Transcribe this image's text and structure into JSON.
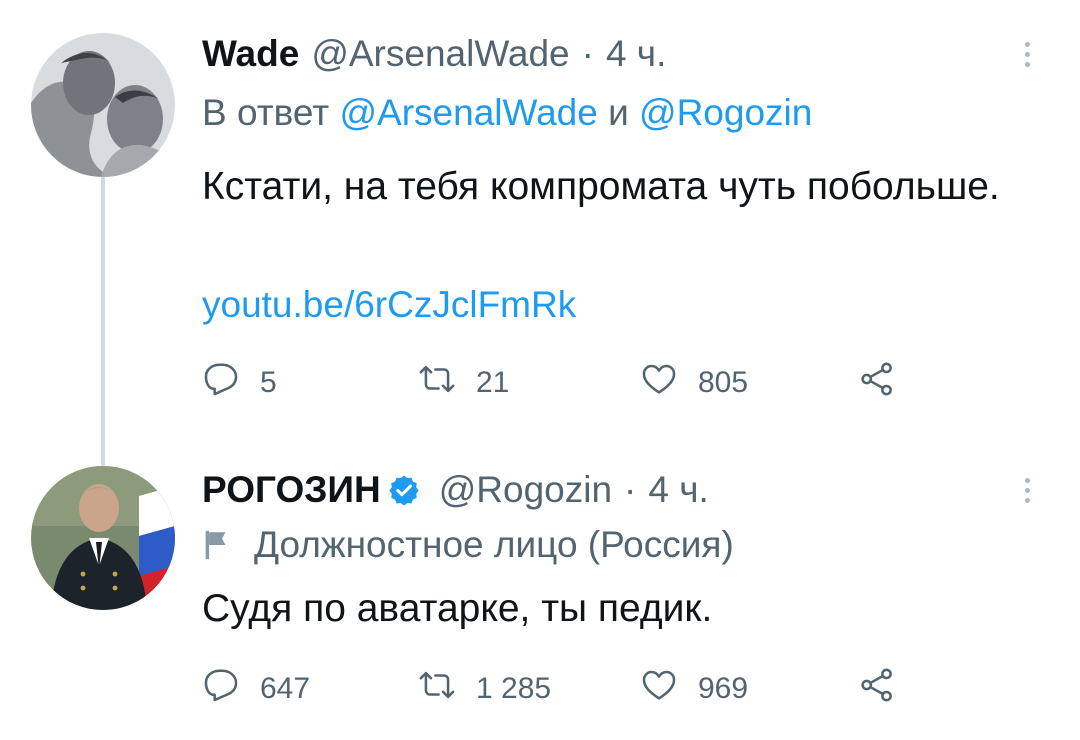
{
  "tweets": [
    {
      "display_name": "Wade",
      "handle": "@ArsenalWade",
      "separator": "·",
      "time": "4 ч.",
      "reply_prefix": "В ответ",
      "reply_mention_1": "@ArsenalWade",
      "reply_joiner": "и",
      "reply_mention_2": "@Rogozin",
      "text": "Кстати, на тебя компромата чуть побольше.",
      "link": "youtu.be/6rCzJclFmRk",
      "replies": "5",
      "retweets": "21",
      "likes": "805",
      "verified": false
    },
    {
      "display_name": "РОГОЗИН",
      "handle": "@Rogozin",
      "separator": "·",
      "time": "4 ч.",
      "label": "Должностное лицо (Россия)",
      "text": "Судя по аватарке, ты педик.",
      "replies": "647",
      "retweets": "1 285",
      "likes": "969",
      "verified": true
    }
  ],
  "icons": {
    "reply": "reply-icon",
    "retweet": "retweet-icon",
    "like": "heart-icon",
    "share": "share-icon",
    "more": "more-icon",
    "verified": "verified-badge-icon",
    "label": "flag-icon"
  },
  "colors": {
    "accent": "#1d9bf0",
    "secondary_text": "#536471",
    "primary_text": "#0f1419",
    "thread_line": "#cfd9de"
  }
}
